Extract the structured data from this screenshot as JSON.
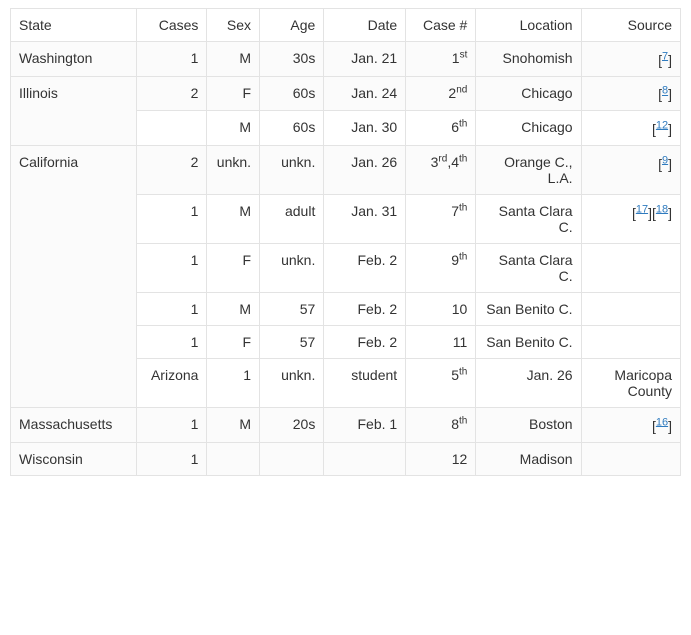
{
  "headers": {
    "state": "State",
    "cases": "Cases",
    "sex": "Sex",
    "age": "Age",
    "date": "Date",
    "case_no": "Case #",
    "location": "Location",
    "source": "Source"
  },
  "rows": [
    {
      "is_first": true,
      "state": "Washington",
      "cases": "1",
      "sex": "M",
      "age": "30s",
      "date": "Jan. 21",
      "case_no": "1",
      "case_sup": "st",
      "location": "Snohomish",
      "sources": [
        7
      ]
    },
    {
      "is_first": true,
      "state": "Illinois",
      "state_rowspan": 2,
      "cases": "2",
      "sex": "F",
      "age": "60s",
      "date": "Jan. 24",
      "case_no": "2",
      "case_sup": "nd",
      "location": "Chicago",
      "sources": [
        8
      ]
    },
    {
      "is_first": false,
      "cases": "",
      "sex": "M",
      "age": "60s",
      "date": "Jan. 30",
      "case_no": "6",
      "case_sup": "th",
      "location": "Chicago",
      "sources": [
        12
      ]
    },
    {
      "is_first": true,
      "state": "California",
      "state_rowspan": 6,
      "cases": "2",
      "sex": "unkn.",
      "age": "unkn.",
      "date": "Jan. 26",
      "case_html": "3<sup>rd</sup>,4<sup>th</sup>",
      "location": "Orange C., L.A.",
      "sources": [
        9
      ]
    },
    {
      "is_first": false,
      "cases": "1",
      "sex": "M",
      "age": "adult",
      "date": "Jan. 31",
      "case_no": "7",
      "case_sup": "th",
      "location": "Santa Clara C.",
      "sources": [
        17,
        18
      ]
    },
    {
      "is_first": false,
      "cases": "1",
      "sex": "F",
      "age": "unkn.",
      "date": "Feb. 2",
      "case_no": "9",
      "case_sup": "th",
      "location": "Santa Clara C.",
      "sources": []
    },
    {
      "is_first": false,
      "cases": "1",
      "sex": "M",
      "age": "57",
      "date": "Feb. 2",
      "case_no": "10",
      "case_sup": "",
      "location": "San Benito C.",
      "sources": []
    },
    {
      "is_first": false,
      "cases": "1",
      "sex": "F",
      "age": "57",
      "date": "Feb. 2",
      "case_no": "11",
      "case_sup": "",
      "location": "San Benito C.",
      "sources": []
    },
    {
      "is_first": false,
      "misaligned": true,
      "cases_col": "Arizona",
      "sex_col": "1",
      "age_col": "unkn.",
      "date_col": "student",
      "case_no": "5",
      "case_sup": "th",
      "location": "Jan. 26",
      "source_text": "Maricopa County"
    },
    {
      "is_first": true,
      "state": "Massachusetts",
      "cases": "1",
      "sex": "M",
      "age": "20s",
      "date": "Feb. 1",
      "case_no": "8",
      "case_sup": "th",
      "location": "Boston",
      "sources": [
        16
      ]
    },
    {
      "is_first": true,
      "state": "Wisconsin",
      "cases": "1",
      "sex": "",
      "age": "",
      "date": "",
      "case_no": "12",
      "case_sup": "",
      "location": "Madison",
      "sources": []
    }
  ]
}
